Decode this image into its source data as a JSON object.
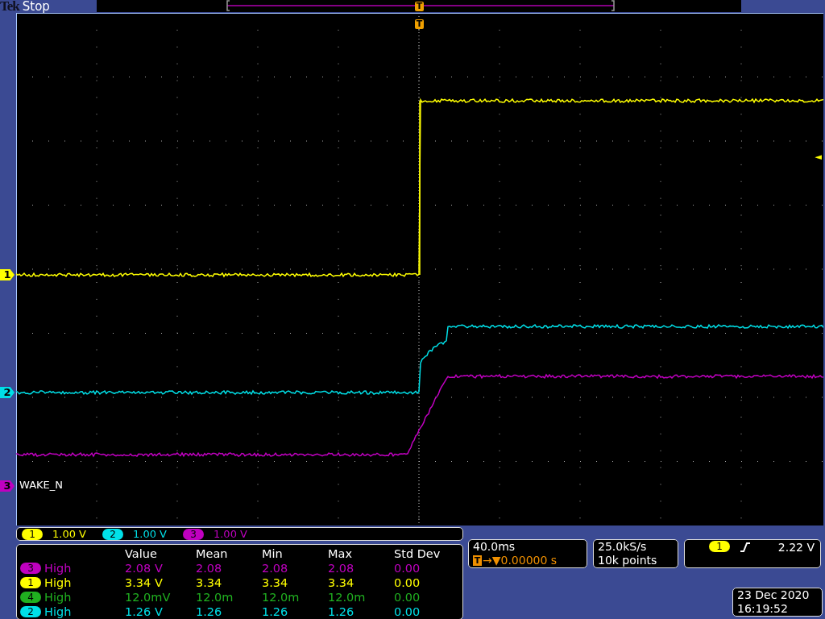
{
  "header": {
    "brand": "Tek",
    "status": "Stop",
    "trigger_marker": "T"
  },
  "graticule": {
    "trigger_marker": "T",
    "trigger_level_marker": "◄"
  },
  "channels": [
    {
      "number": "1",
      "color": "#ffff00"
    },
    {
      "number": "2",
      "color": "#00e0e8"
    },
    {
      "number": "3",
      "color": "#c000c0",
      "label": "WAKE_N"
    }
  ],
  "scale_bar": [
    {
      "channel": "1",
      "color": "#ffff00",
      "scale": "1.00 V"
    },
    {
      "channel": "2",
      "color": "#00e0e8",
      "scale": "1.00 V"
    },
    {
      "channel": "3",
      "color": "#c000c0",
      "scale": "1.00 V"
    }
  ],
  "measurements": {
    "columns": [
      "Value",
      "Mean",
      "Min",
      "Max",
      "Std Dev"
    ],
    "rows": [
      {
        "channel": "3",
        "color": "#c000c0",
        "type": "High",
        "values": [
          "2.08 V",
          "2.08",
          "2.08",
          "2.08",
          "0.00"
        ]
      },
      {
        "channel": "1",
        "color": "#ffff00",
        "type": "High",
        "values": [
          "3.34 V",
          "3.34",
          "3.34",
          "3.34",
          "0.00"
        ]
      },
      {
        "channel": "4",
        "color": "#20b020",
        "type": "High",
        "values": [
          "12.0mV",
          "12.0m",
          "12.0m",
          "12.0m",
          "0.00"
        ]
      },
      {
        "channel": "2",
        "color": "#00e0e8",
        "type": "High",
        "values": [
          "1.26 V",
          "1.26",
          "1.26",
          "1.26",
          "0.00"
        ]
      }
    ]
  },
  "timebase": {
    "scale": "40.0ms",
    "marker": "T",
    "arrow": "→▼",
    "position": "0.00000 s"
  },
  "acquisition": {
    "rate": "25.0kS/s",
    "record": "10k points"
  },
  "trigger": {
    "channel": "1",
    "color": "#ffff00",
    "rising_edge": true,
    "level": "2.22 V"
  },
  "datetime": {
    "date": "23 Dec 2020",
    "time": "16:19:52"
  }
}
